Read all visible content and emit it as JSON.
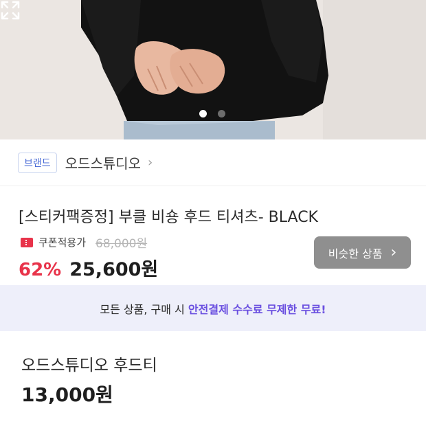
{
  "gallery": {
    "slides_total": 2,
    "active_slide": 1,
    "expand_icon": "expand-icon"
  },
  "brand": {
    "badge": "브랜드",
    "name": "오드스튜디오",
    "chevron": "›"
  },
  "product": {
    "title": "[스티커팩증정] 부클 비숑 후드 티셔츠- BLACK",
    "coupon_icon": "coupon-ticket-icon",
    "coupon_label": "쿠폰적용가",
    "original_price": "68,000원",
    "discount": "62%",
    "price": "25,600원",
    "accent_color": "#e8334a"
  },
  "similar_button": {
    "label": "비슷한 상품",
    "chevron": "›"
  },
  "banner": {
    "text_plain": "모든 상품, 구매 시 ",
    "text_highlight": "안전결제 수수료 무제한 무료!",
    "highlight_color": "#6a4fe0"
  },
  "second_product": {
    "name": "오드스튜디오 후드티",
    "price": "13,000원"
  }
}
